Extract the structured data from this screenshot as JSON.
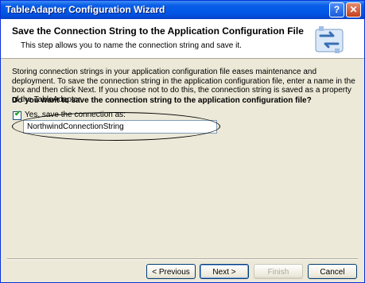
{
  "window": {
    "title": "TableAdapter Configuration Wizard",
    "help_label": "?",
    "close_label": "✕"
  },
  "header": {
    "title": "Save the Connection String to the Application Configuration File",
    "subtitle": "This step allows you to name the connection string and save it."
  },
  "body": {
    "description": "Storing connection strings in your application configuration file eases maintenance and deployment. To save the connection string in the application configuration file, enter a name in the box and then click Next. If you choose not to do this, the connection string is saved as a property of the TableAdapter.",
    "question": "Do you want to save the connection string to the application configuration file?",
    "checkbox_label": "Yes, save the connection as:",
    "checkbox_checked": true,
    "connection_name": "NorthwindConnectionString"
  },
  "buttons": {
    "previous": "< Previous",
    "next": "Next >",
    "finish": "Finish",
    "cancel": "Cancel"
  },
  "colors": {
    "titlebar": "#0055e5",
    "annotation": "#000000"
  },
  "icons": {
    "header": "wizard-refresh-icon",
    "check": "checkmark-icon"
  }
}
